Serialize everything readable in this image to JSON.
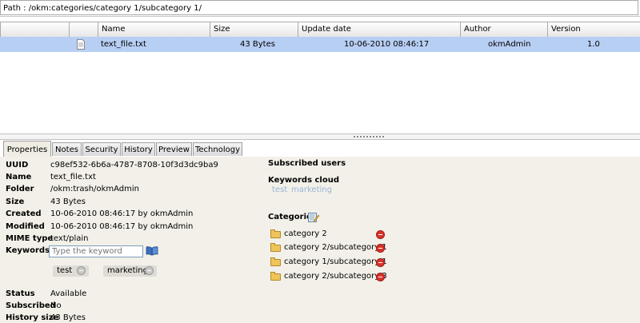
{
  "path": "Path : /okm:categories/category 1/subcategory 1/",
  "grid": {
    "columns": [
      "Name",
      "Size",
      "Update date",
      "Author",
      "Version"
    ],
    "rows": [
      {
        "icon": "document-icon",
        "name": "text_file.txt",
        "size": "43 Bytes",
        "update_date": "10-06-2010 08:46:17",
        "author": "okmAdmin",
        "version": "1.0"
      }
    ]
  },
  "tabs": [
    "Properties",
    "Notes",
    "Security",
    "History",
    "Preview",
    "Technology"
  ],
  "properties": {
    "uuid": {
      "label": "UUID",
      "value": "c98ef532-6b6a-4787-8708-10f3d3dc9ba9"
    },
    "name": {
      "label": "Name",
      "value": "text_file.txt"
    },
    "folder": {
      "label": "Folder",
      "value": "/okm:trash/okmAdmin"
    },
    "size": {
      "label": "Size",
      "value": "43 Bytes"
    },
    "created": {
      "label": "Created",
      "value": "10-06-2010 08:46:17 by okmAdmin"
    },
    "modified": {
      "label": "Modified",
      "value": "10-06-2010 08:46:17 by okmAdmin"
    },
    "mime": {
      "label": "MIME type",
      "value": "text/plain"
    },
    "keywords": {
      "label": "Keywords",
      "placeholder": "Type the keyword",
      "items": [
        "test",
        "marketing"
      ]
    },
    "status": {
      "label": "Status",
      "value": "Available"
    },
    "subscribed": {
      "label": "Subscribed",
      "value": "No"
    },
    "history_size": {
      "label": "History size",
      "value": "43 Bytes"
    }
  },
  "right": {
    "subscribed_users": "Subscribed users",
    "keywords_cloud": "Keywords cloud",
    "cloud": [
      "test",
      "marketing"
    ],
    "categories_title": "Categories",
    "categories": [
      "category 2",
      "category 2/subcategory 1",
      "category 1/subcategory 1",
      "category 2/subcategory 3"
    ]
  }
}
